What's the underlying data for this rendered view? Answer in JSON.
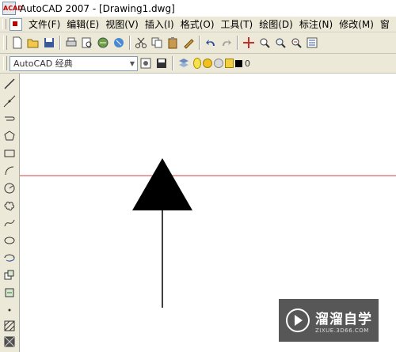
{
  "window": {
    "title": "AutoCAD 2007 - [Drawing1.dwg]",
    "app_icon": "autocad-icon",
    "app_icon_text": "ACAD"
  },
  "menu": {
    "items": [
      "文件(F)",
      "编辑(E)",
      "视图(V)",
      "插入(I)",
      "格式(O)",
      "工具(T)",
      "绘图(D)",
      "标注(N)",
      "修改(M)",
      "窗"
    ]
  },
  "workspace": {
    "selected": "AutoCAD 经典"
  },
  "layer": {
    "current": "0"
  },
  "toolbar_icons": [
    "new-icon",
    "open-icon",
    "save-icon",
    "plot-icon",
    "plot-preview-icon",
    "publish-icon",
    "3d-dwf-icon",
    "cut-icon",
    "copy-icon",
    "paste-icon",
    "match-properties-icon",
    "undo-icon",
    "redo-icon",
    "pan-icon",
    "zoom-realtime-icon",
    "zoom-window-icon",
    "zoom-previous-icon",
    "properties-icon"
  ],
  "draw_toolbar_icons": [
    "line-icon",
    "construction-line-icon",
    "polyline-icon",
    "polygon-icon",
    "rectangle-icon",
    "arc-icon",
    "circle-icon",
    "revision-cloud-icon",
    "spline-icon",
    "ellipse-icon",
    "ellipse-arc-icon",
    "insert-block-icon",
    "make-block-icon",
    "point-icon",
    "hatch-icon",
    "gradient-icon"
  ],
  "colors": {
    "crosshair": "#d04040",
    "arrow": "#000000",
    "toolbar_bg": "#ece9d8"
  },
  "watermark": {
    "title": "溜溜自学",
    "url": "ZIXUE.3D66.COM"
  }
}
